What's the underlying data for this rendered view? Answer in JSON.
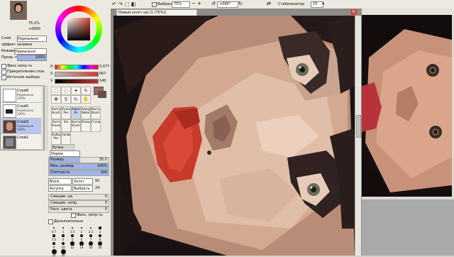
{
  "left_panel": {
    "navigator_zoom": "75.2%",
    "navigator_angle": "+0000",
    "fields": [
      {
        "label": "Слой",
        "value": "Нормально"
      },
      {
        "label": "эффект заливки",
        "value": ""
      },
      {
        "label": "Режим",
        "value": "Нормально"
      },
      {
        "label": "Прозр.-ть",
        "value": "100%"
      }
    ],
    "checks": [
      "Фикс непр-ть",
      "Прикрепление слоя",
      "Источник выбора"
    ],
    "layers": [
      {
        "name": "Слой6",
        "mode": "Нормально",
        "opacity": "100%"
      },
      {
        "name": "Слой5",
        "mode": "Нормально",
        "opacity": "100%"
      },
      {
        "name": "Слой3",
        "mode": "Нормально",
        "opacity": "100%"
      },
      {
        "name": "Слой1",
        "mode": "",
        "opacity": ""
      }
    ]
  },
  "tool_panel": {
    "sliders": [
      {
        "label": "H",
        "value": "0.077",
        "color": "#e0403a",
        "level": 0.08
      },
      {
        "label": "S",
        "value": "067",
        "color": "#c05050",
        "level": 0.26
      },
      {
        "label": "V",
        "value": "140",
        "color": "#9b6660",
        "level": 0.55
      }
    ],
    "tools": [
      {
        "name": "Кисть",
        "sub": "Brush"
      },
      {
        "name": "Ручка",
        "sub": "Pen"
      },
      {
        "name": "Аэрограф",
        "sub": "Air"
      },
      {
        "name": "Акварель",
        "sub": "Water"
      },
      {
        "name": "Кисть",
        "sub": "Brush"
      },
      {
        "name": "Ластик",
        "sub": "Eraser"
      },
      {
        "name": "Sel",
        "sub": ""
      },
      {
        "name": "Кисть",
        "sub": "Brush"
      },
      {
        "name": "Размыт.",
        "sub": ""
      },
      {
        "name": "Сглаж.",
        "sub": ""
      },
      {
        "name": "Выбор",
        "sub": "Pen"
      },
      {
        "name": "Заливка",
        "sub": ""
      }
    ],
    "tab_label": "Ручка",
    "brush_mode": "Норма",
    "params": [
      {
        "label": "Размер",
        "value": "35.0",
        "level": 0.52
      },
      {
        "label": "Мин. размер",
        "value": "100%",
        "level": 1.0
      },
      {
        "label": "Плотность",
        "value": "100",
        "level": 1.0
      }
    ],
    "dropdowns": [
      {
        "label": "Block",
        "value": "Холст",
        "extra": "50"
      },
      {
        "label": "Acrylica",
        "value": "Выбрать",
        "extra": "24"
      }
    ],
    "params2": [
      {
        "label": "Смешив. цв.",
        "value": "0",
        "level": 0.0
      },
      {
        "label": "Смешив. непр.",
        "value": "0",
        "level": 0.0
      },
      {
        "label": "Расп. цвета",
        "value": "0",
        "level": 0.0
      }
    ],
    "fix_opacity_label": "Фикс. непр-ть",
    "extra_label": "Дополнительно",
    "brush_sizes": [
      "0.7",
      "1",
      "1.5",
      "2",
      "2.3",
      "3",
      "3.5",
      "4",
      "5",
      "6",
      "7",
      "8",
      "9",
      "10",
      "12",
      "14",
      "16",
      "20",
      "25",
      "30"
    ]
  },
  "toolbar": {
    "select_label": "Выбрано",
    "zoom": "75%",
    "angle": "+090°",
    "stabilizer_label": "Стабилизатор",
    "stabilizer_value": "15"
  },
  "canvas": {
    "title": "Новый холст.sai (1 (75%))"
  }
}
